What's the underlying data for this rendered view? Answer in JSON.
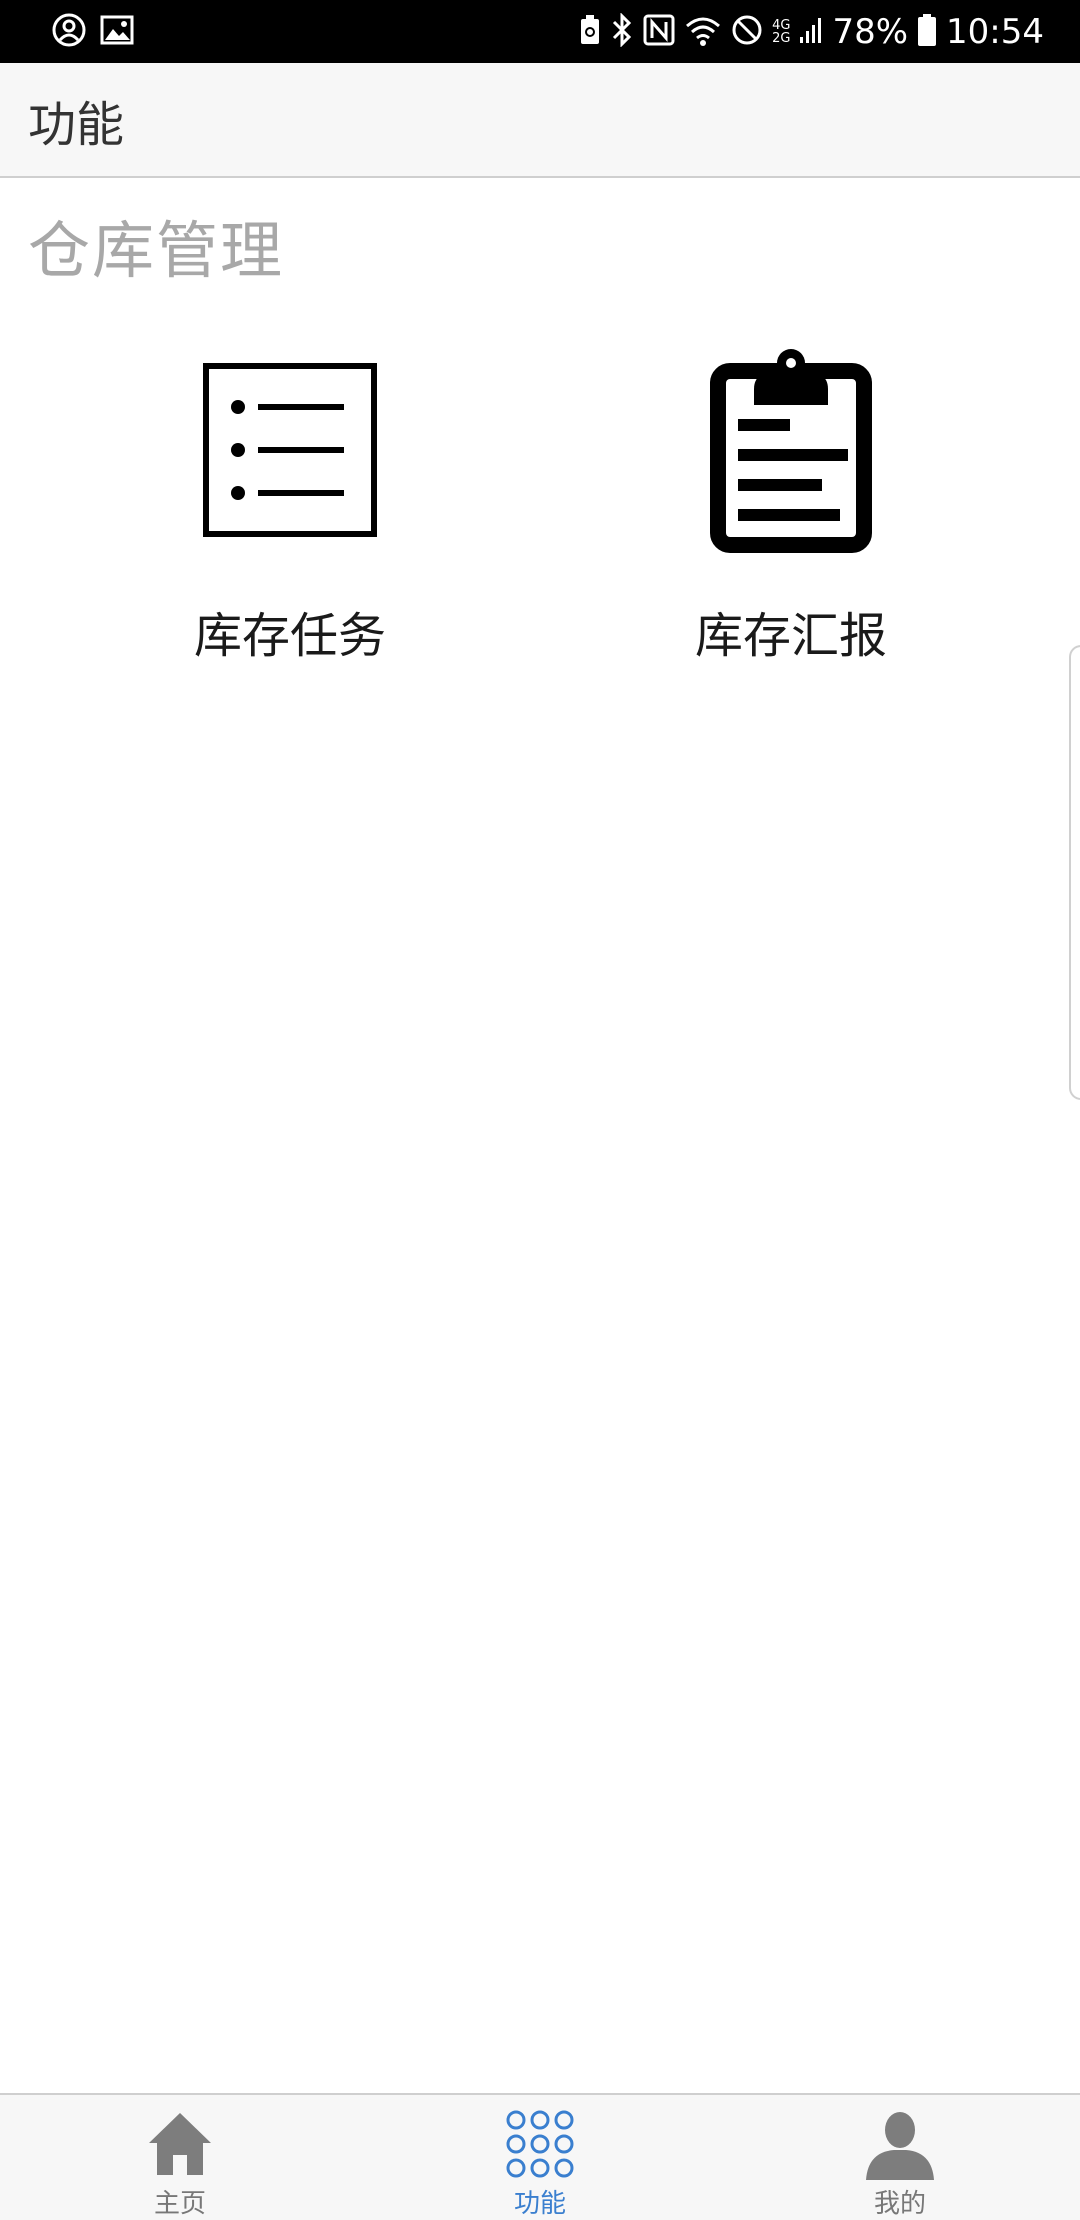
{
  "status_bar": {
    "left_icons": [
      "account-icon",
      "image-icon"
    ],
    "right_icons": [
      "battery-saver-icon",
      "bluetooth-icon",
      "nfc-icon",
      "wifi-icon",
      "do-not-disturb-icon",
      "signal-icon",
      "battery-icon"
    ],
    "network_top": "4G",
    "network_bottom": "2G",
    "battery": "78%",
    "time": "10:54"
  },
  "app_bar": {
    "title": "功能"
  },
  "section": {
    "title": "仓库管理",
    "items": [
      {
        "label": "库存任务",
        "icon": "list-icon"
      },
      {
        "label": "库存汇报",
        "icon": "clipboard-icon"
      }
    ]
  },
  "bottom_nav": {
    "active_color": "#3a7fcf",
    "inactive_color": "#777777",
    "items": [
      {
        "label": "主页",
        "icon": "home-icon",
        "active": false
      },
      {
        "label": "功能",
        "icon": "apps-grid-icon",
        "active": true
      },
      {
        "label": "我的",
        "icon": "profile-icon",
        "active": false
      }
    ]
  }
}
